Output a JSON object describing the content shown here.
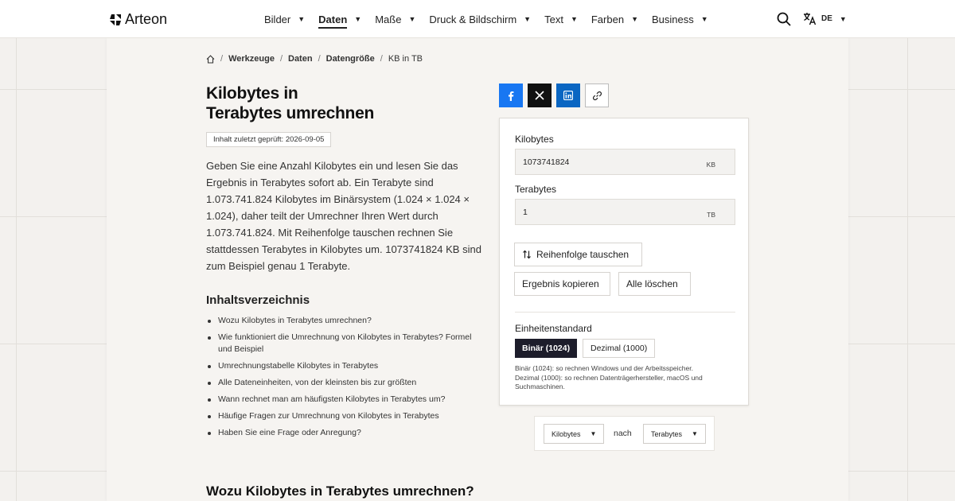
{
  "brand": {
    "name": "Arteon"
  },
  "nav": {
    "items": [
      {
        "label": "Bilder"
      },
      {
        "label": "Daten",
        "active": true
      },
      {
        "label": "Maße"
      },
      {
        "label": "Druck & Bildschirm"
      },
      {
        "label": "Text"
      },
      {
        "label": "Farben"
      },
      {
        "label": "Business"
      }
    ],
    "language": "DE",
    "icons": {
      "search": "search-icon",
      "language": "translate-icon",
      "home": "home-icon"
    }
  },
  "breadcrumb": {
    "items": [
      "Werkzeuge",
      "Daten",
      "Datengröße",
      "KB in TB"
    ]
  },
  "page": {
    "title_line1": "Kilobytes in",
    "title_line2": "Terabytes umrechnen",
    "reviewed": "Inhalt zuletzt geprüft: 2026-09-05",
    "intro": "Geben Sie eine Anzahl Kilobytes ein und lesen Sie das Ergebnis in Terabytes sofort ab. Ein Terabyte sind 1.073.741.824 Kilobytes im Binärsystem (1.024 × 1.024 × 1.024), daher teilt der Umrechner Ihren Wert durch 1.073.741.824. Mit Reihenfolge tauschen rechnen Sie stattdessen Terabytes in Kilobytes um. 1073741824 KB sind zum Beispiel genau 1 Terabyte."
  },
  "toc": {
    "title": "Inhaltsverzeichnis",
    "items": [
      "Wozu Kilobytes in Terabytes umrechnen?",
      "Wie funktioniert die Umrechnung von Kilobytes in Terabytes? Formel und Beispiel",
      "Umrechnungstabelle Kilobytes in Terabytes",
      "Alle Dateneinheiten, von der kleinsten bis zur größten",
      "Wann rechnet man am häufigsten Kilobytes in Terabytes um?",
      "Häufige Fragen zur Umrechnung von Kilobytes in Terabytes",
      "Haben Sie eine Frage oder Anregung?"
    ]
  },
  "section": {
    "heading": "Wozu Kilobytes in Terabytes umrechnen?"
  },
  "share": {
    "icons": [
      "facebook-icon",
      "x-icon",
      "linkedin-icon",
      "link-icon"
    ],
    "colors": {
      "facebook": "#1877f2",
      "x": "#111111",
      "linkedin": "#0a66c2"
    }
  },
  "converter": {
    "from_label": "Kilobytes",
    "from_value": "1073741824",
    "from_unit": "KB",
    "to_label": "Terabytes",
    "to_value": "1",
    "to_unit": "TB",
    "swap_label": "Reihenfolge tauschen",
    "copy_label": "Ergebnis kopieren",
    "clear_label": "Alle löschen",
    "standard_title": "Einheitenstandard",
    "std_binary": "Binär (1024)",
    "std_decimal": "Dezimal (1000)",
    "std_selected": "Binär (1024)",
    "note_line1": "Binär (1024): so rechnen Windows und der Arbeitsspeicher.",
    "note_line2": "Dezimal (1000): so rechnen Datenträgerhersteller, macOS und Suchmaschinen."
  },
  "unit_picker": {
    "from": "Kilobytes",
    "connector": "nach",
    "to": "Terabytes"
  }
}
